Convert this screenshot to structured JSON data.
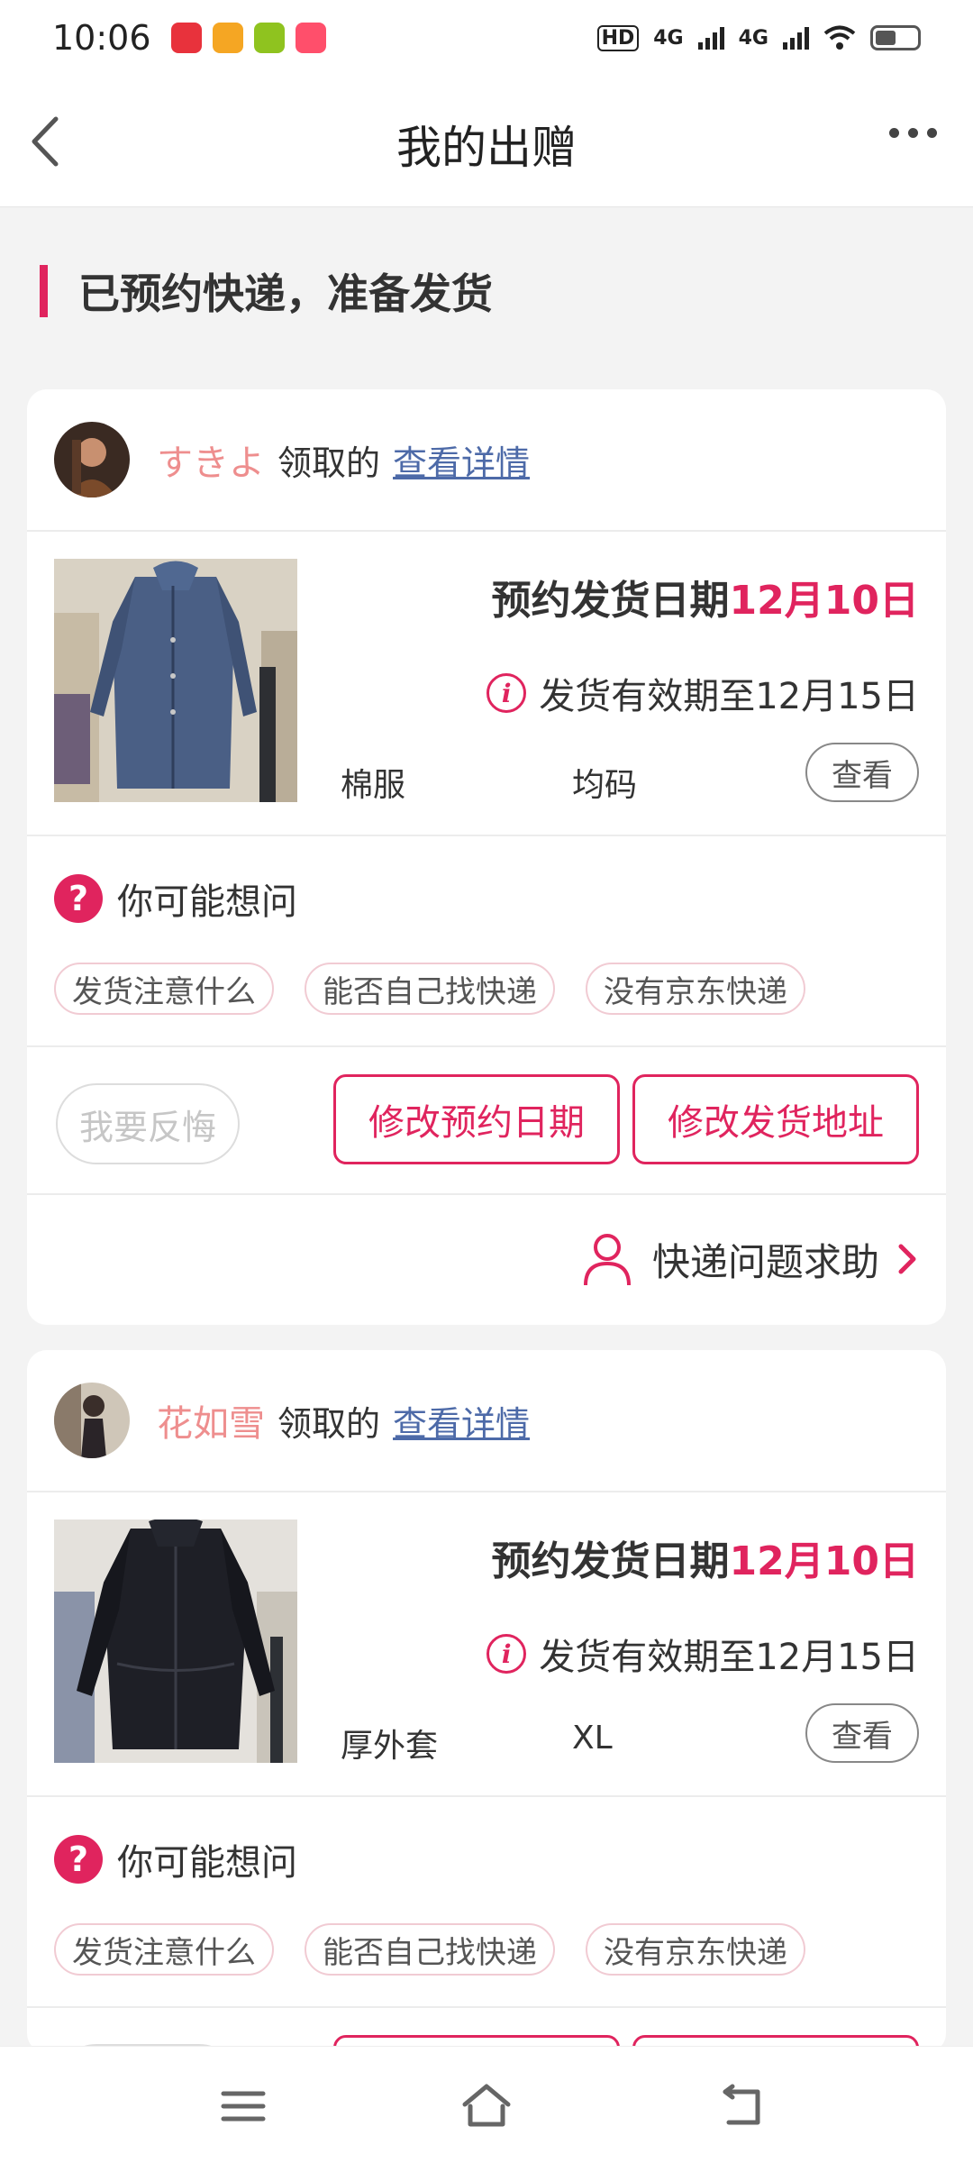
{
  "status_bar": {
    "time": "10:06",
    "network_1": "4G",
    "network_2": "4G",
    "hd_label": "HD"
  },
  "header": {
    "title": "我的出赠"
  },
  "section": {
    "title": "已预约快递，准备发货"
  },
  "cards": [
    {
      "receiver": "すきよ",
      "claim_text": "领取的",
      "detail_link": "查看详情",
      "ship_date_label": "预约发货日期",
      "ship_date": "12月10日",
      "valid_text": "发货有效期至12月15日",
      "item_name": "棉服",
      "item_size": "均码",
      "view_label": "查看",
      "faq_title": "你可能想问",
      "faq_chips": [
        "发货注意什么",
        "能否自己找快递",
        "没有京东快递"
      ],
      "regret_label": "我要反悔",
      "change_date_label": "修改预约日期",
      "change_address_label": "修改发货地址",
      "help_label": "快递问题求助"
    },
    {
      "receiver": "花如雪",
      "claim_text": "领取的",
      "detail_link": "查看详情",
      "ship_date_label": "预约发货日期",
      "ship_date": "12月10日",
      "valid_text": "发货有效期至12月15日",
      "item_name": "厚外套",
      "item_size": "XL",
      "view_label": "查看",
      "faq_title": "你可能想问",
      "faq_chips": [
        "发货注意什么",
        "能否自己找快递",
        "没有京东快递"
      ]
    }
  ],
  "colors": {
    "accent": "#e0245e",
    "receiver_name": "#ee8e8e",
    "link": "#4d6aa8"
  }
}
